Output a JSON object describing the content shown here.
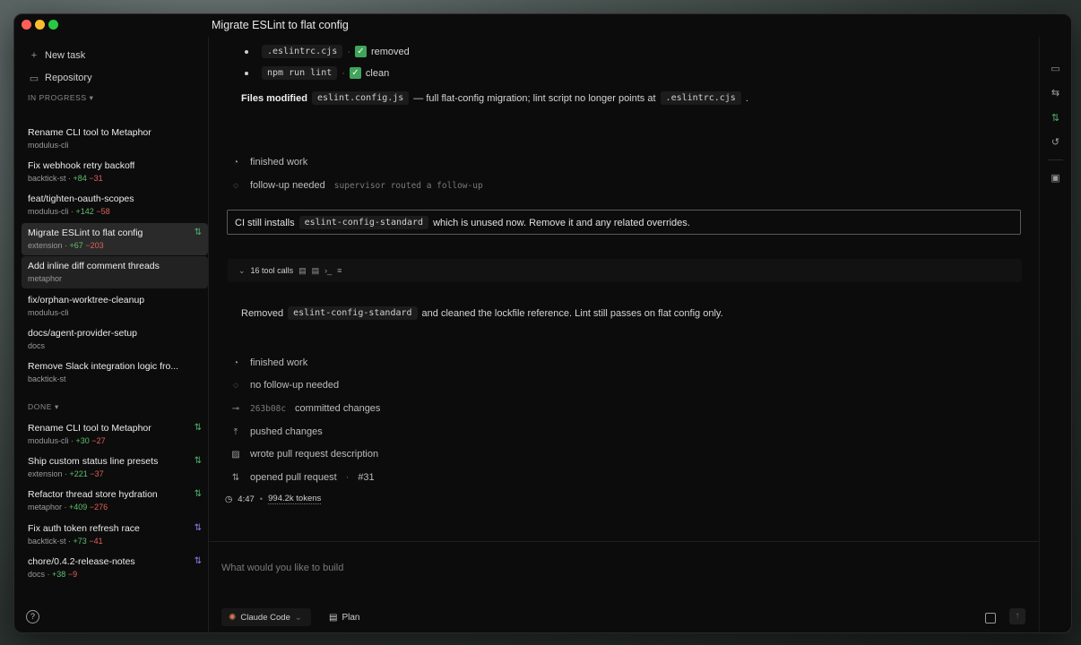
{
  "window": {
    "title": "Migrate ESLint to flat config"
  },
  "sidebar": {
    "new_task": "New task",
    "repository": "Repository",
    "in_progress_label": "IN PROGRESS",
    "done_label": "DONE",
    "in_progress": [
      {
        "title": "Rename CLI tool to Metaphor",
        "meta": "modulus-cli",
        "plus": "",
        "minus": ""
      },
      {
        "title": "Fix webhook retry backoff",
        "meta": "backtick-st · ",
        "plus": "+84",
        "minus": "−31"
      },
      {
        "title": "feat/tighten-oauth-scopes",
        "meta": "modulus-cli · ",
        "plus": "+142",
        "minus": "−58"
      },
      {
        "title": "Migrate ESLint to flat config",
        "meta": "extension · ",
        "plus": "+67",
        "minus": "−203"
      },
      {
        "title": "Add inline diff comment threads",
        "meta": "metaphor",
        "plus": "",
        "minus": ""
      },
      {
        "title": "fix/orphan-worktree-cleanup",
        "meta": "modulus-cli",
        "plus": "",
        "minus": ""
      },
      {
        "title": "docs/agent-provider-setup",
        "meta": "docs",
        "plus": "",
        "minus": ""
      },
      {
        "title": "Remove Slack integration logic fro...",
        "meta": "backtick-st",
        "plus": "",
        "minus": ""
      }
    ],
    "done": [
      {
        "title": "Rename CLI tool to Metaphor",
        "meta": "modulus-cli · ",
        "plus": "+30",
        "minus": "−27"
      },
      {
        "title": "Ship custom status line presets",
        "meta": "extension · ",
        "plus": "+221",
        "minus": "−37"
      },
      {
        "title": "Refactor thread store hydration",
        "meta": "metaphor · ",
        "plus": "+409",
        "minus": "−276"
      },
      {
        "title": "Fix auth token refresh race",
        "meta": "backtick-st · ",
        "plus": "+73",
        "minus": "−41"
      },
      {
        "title": "chore/0.4.2-release-notes",
        "meta": "docs · ",
        "plus": "+38",
        "minus": "−9"
      }
    ]
  },
  "main": {
    "bullet1_code": ".eslintrc.cjs",
    "bullet1_sep": "·",
    "bullet1_text": "removed",
    "bullet2_code": "npm run lint",
    "bullet2_sep": "·",
    "bullet2_text": "clean",
    "files_label": "Files modified",
    "files_code": "eslint.config.js",
    "files_text": "— full flat-config migration; lint script no longer points at",
    "files_code2": ".eslintrc.cjs",
    "files_end": ".",
    "ev1": "finished work",
    "ev2": "follow-up needed",
    "ev2_note": "supervisor routed a follow-up",
    "followup_pre": "CI still installs",
    "followup_code": "eslint-config-standard",
    "followup_post": "which is unused now. Remove it and any related overrides.",
    "tool_calls": "16 tool calls",
    "result_pre": "Removed",
    "result_code": "eslint-config-standard",
    "result_post": "and cleaned the lockfile reference. Lint still passes on flat config only.",
    "ev3": "finished work",
    "ev4": "no follow-up needed",
    "ev5_hash": "263b08c",
    "ev5": "committed changes",
    "ev6": "pushed changes",
    "ev7": "wrote pull request description",
    "ev8": "opened pull request",
    "ev8_pr": "#31",
    "duration": "4:47",
    "stats_sep": "•",
    "tokens": "994.2k tokens"
  },
  "composer": {
    "placeholder": "What would you like to build",
    "agent": "Claude Code",
    "plan": "Plan"
  }
}
